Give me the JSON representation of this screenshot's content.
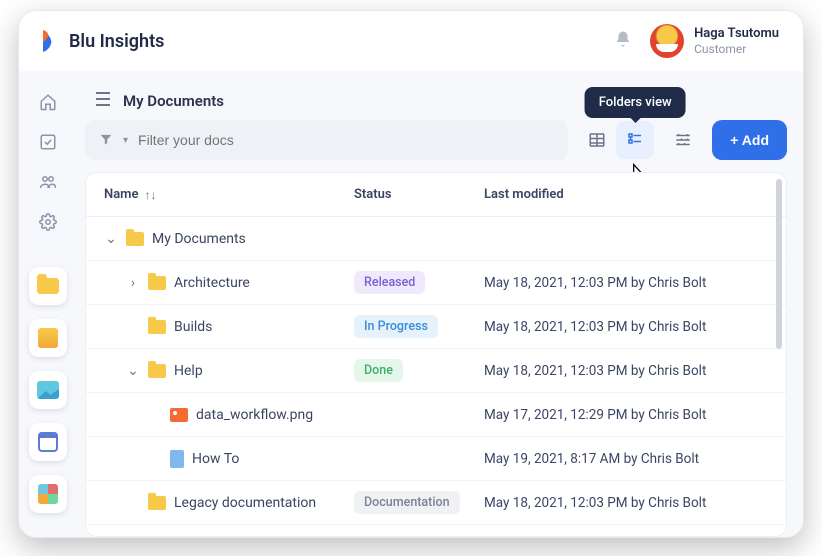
{
  "brand": "Blu Insights",
  "user": {
    "name": "Haga Tsutomu",
    "role": "Customer"
  },
  "page_title": "My Documents",
  "filter": {
    "placeholder": "Filter your docs"
  },
  "tooltip_folders_view": "Folders view",
  "add_label": "+ Add",
  "columns": {
    "name": "Name",
    "status": "Status",
    "modified": "Last modified"
  },
  "rows": [
    {
      "indent": 0,
      "caret": "down",
      "icon": "folder",
      "name": "My Documents",
      "status": "",
      "status_kind": "",
      "modified": ""
    },
    {
      "indent": 1,
      "caret": "right",
      "icon": "folder",
      "name": "Architecture",
      "status": "Released",
      "status_kind": "released",
      "modified": "May 18, 2021, 12:03 PM by Chris Bolt"
    },
    {
      "indent": 1,
      "caret": "",
      "icon": "folder",
      "name": "Builds",
      "status": "In Progress",
      "status_kind": "progress",
      "modified": "May 18, 2021, 12:03 PM by Chris Bolt"
    },
    {
      "indent": 1,
      "caret": "down",
      "icon": "folder",
      "name": "Help",
      "status": "Done",
      "status_kind": "done",
      "modified": "May 18, 2021, 12:03 PM by Chris Bolt"
    },
    {
      "indent": 2,
      "caret": "",
      "icon": "image",
      "name": "data_workflow.png",
      "status": "",
      "status_kind": "",
      "modified": "May 17, 2021, 12:29 PM by Chris Bolt"
    },
    {
      "indent": 2,
      "caret": "",
      "icon": "doc",
      "name": "How To",
      "status": "",
      "status_kind": "",
      "modified": "May 19, 2021, 8:17 AM by Chris Bolt"
    },
    {
      "indent": 1,
      "caret": "",
      "icon": "folder",
      "name": "Legacy documentation",
      "status": "Documentation",
      "status_kind": "doc",
      "modified": "May 18, 2021, 12:03 PM by Chris Bolt"
    }
  ]
}
